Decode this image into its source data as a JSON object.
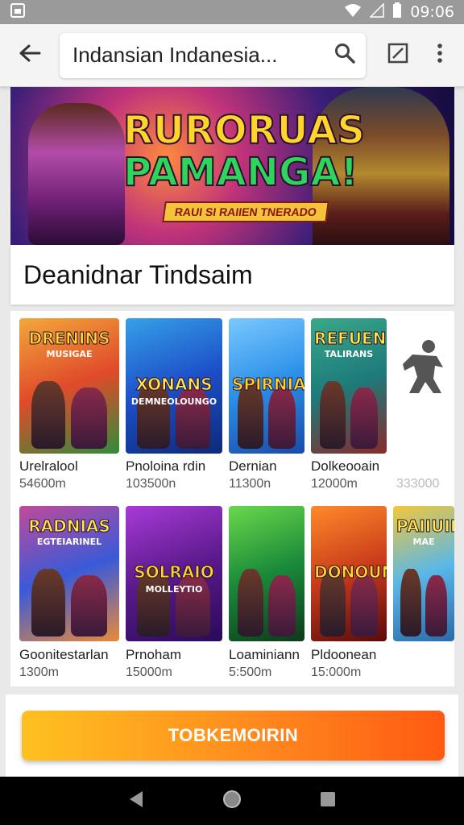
{
  "status": {
    "time": "09:06"
  },
  "toolbar": {
    "search_text": "Indansian Indanesia..."
  },
  "banner": {
    "title_line1": "RURORUAS",
    "title_line2": "PAMANGA!",
    "subtitle": "RAUI SI RAIIEN TNERADO"
  },
  "section": {
    "title": "Deanidnar Tindsaim"
  },
  "games": [
    {
      "title": "DRENINS",
      "subtitle": "MUSIGAE",
      "name": "Urelralool",
      "meta": "54600m",
      "colors": [
        "#e04a2a",
        "#f2a83b",
        "#2f8d3a"
      ]
    },
    {
      "title": "XONANS",
      "subtitle": "DEMNEOLOUNGO",
      "name": "Pnoloina rdin",
      "meta": "103500n",
      "colors": [
        "#1d4ec8",
        "#36a0e8",
        "#0d2a7a"
      ]
    },
    {
      "title": "SPIRNIAS",
      "subtitle": "",
      "name": "Dernian",
      "meta": "11300n",
      "colors": [
        "#2a8fe8",
        "#7ac8ff",
        "#1a4aa8"
      ]
    },
    {
      "title": "REFUEN",
      "subtitle": "TALIRANS",
      "name": "Dolkeooain",
      "meta": "12000m",
      "colors": [
        "#1d7a7a",
        "#3aa88a",
        "#8a2a2a"
      ]
    },
    {
      "title": "",
      "subtitle": "",
      "name": "",
      "meta": "333000",
      "colors": [
        "#ffffff",
        "#ffffff",
        "#ffffff"
      ]
    },
    {
      "title": "RADNIAS",
      "subtitle": "EGTEIARINEL",
      "name": "Goonitestarlan",
      "meta": "1300m",
      "colors": [
        "#3a5ad8",
        "#c04a9a",
        "#e88a3a"
      ]
    },
    {
      "title": "SOLRAIO",
      "subtitle": "MOLLEYTIO",
      "name": "Prnoham",
      "meta": "15000m",
      "colors": [
        "#5a1a8a",
        "#a83ad8",
        "#2a0a5a"
      ]
    },
    {
      "title": "",
      "subtitle": "",
      "name": "Loaminiann",
      "meta": "5:500m",
      "colors": [
        "#1a8a3a",
        "#6ad84a",
        "#0d3a1a"
      ]
    },
    {
      "title": "DONOUNS",
      "subtitle": "",
      "name": "Pldoonean",
      "meta": "15:000m",
      "colors": [
        "#c83a1a",
        "#ff8a2a",
        "#5a0a0a"
      ]
    },
    {
      "title": "PAIIUII",
      "subtitle": "MAE",
      "name": "",
      "meta": "",
      "colors": [
        "#5ab8e8",
        "#f2c83a",
        "#2a6aa8"
      ]
    }
  ],
  "cta": {
    "label": "TOBKEMOIRIN"
  },
  "theme": {
    "accent": "#ff8a1e",
    "status_bar": "#9a9a9a",
    "nav_bar": "#000000"
  }
}
